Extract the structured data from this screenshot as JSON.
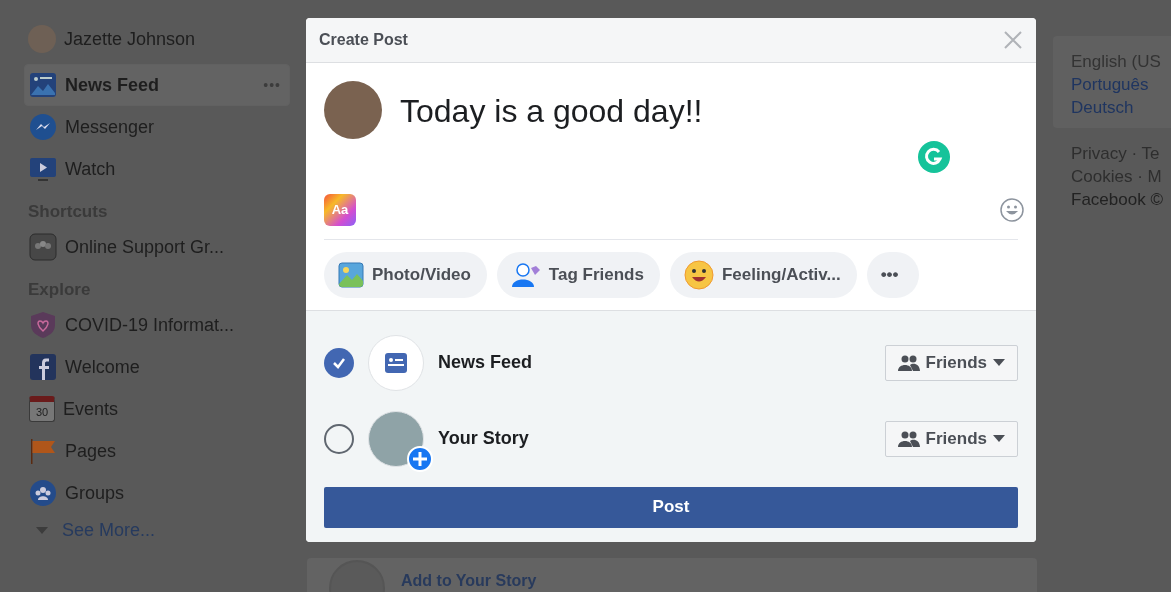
{
  "sidebar": {
    "profile": {
      "name": "Jazette Johnson"
    },
    "items": [
      {
        "label": "News Feed",
        "selected": true,
        "more": "•••"
      },
      {
        "label": "Messenger",
        "selected": false
      },
      {
        "label": "Watch",
        "selected": false
      }
    ],
    "sections": [
      {
        "title": "Shortcuts",
        "items": [
          {
            "label": "Online Support Gr..."
          }
        ]
      },
      {
        "title": "Explore",
        "items": [
          {
            "label": "COVID-19 Informat..."
          },
          {
            "label": "Welcome"
          },
          {
            "label": "Events",
            "badge": "30"
          },
          {
            "label": "Pages"
          },
          {
            "label": "Groups"
          }
        ]
      }
    ],
    "see_more": "See More..."
  },
  "story_card": {
    "label": "Add to Your Story"
  },
  "right_column": {
    "languages": [
      {
        "label": "English (US",
        "selected": true
      },
      {
        "label": "Português",
        "selected": false
      },
      {
        "label": "Deutsch",
        "selected": false
      }
    ],
    "footer": [
      "Privacy · Te",
      "Cookies · M",
      "Facebook ©"
    ]
  },
  "modal": {
    "title": "Create Post",
    "post_text": "Today is a good day!!",
    "text_style_label": "Aa",
    "actions": [
      {
        "label": "Photo/Video",
        "kind": "photo"
      },
      {
        "label": "Tag Friends",
        "kind": "tag"
      },
      {
        "label": "Feeling/Activ...",
        "kind": "feeling"
      },
      {
        "label": "•••",
        "kind": "more"
      }
    ],
    "destinations": [
      {
        "label": "News Feed",
        "checked": true,
        "kind": "feed",
        "audience": "Friends"
      },
      {
        "label": "Your Story",
        "checked": false,
        "kind": "story",
        "audience": "Friends"
      }
    ],
    "submit": "Post"
  }
}
